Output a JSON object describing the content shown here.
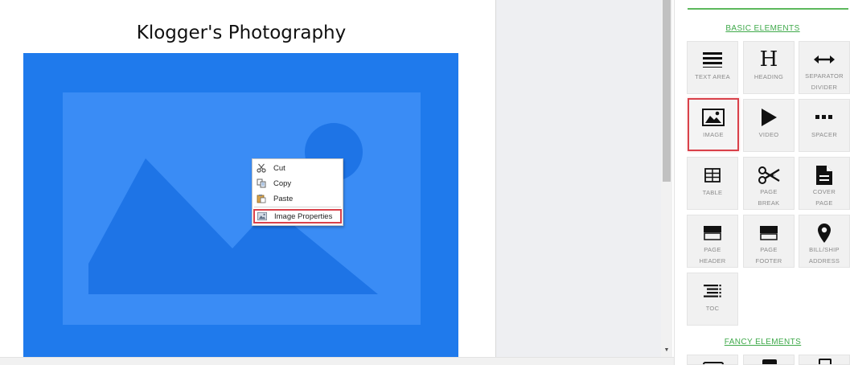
{
  "document": {
    "title": "Klogger's Photography"
  },
  "context_menu": {
    "items": [
      {
        "label": "Cut",
        "icon": "scissors-icon"
      },
      {
        "label": "Copy",
        "icon": "copy-icon"
      },
      {
        "label": "Paste",
        "icon": "paste-icon"
      },
      {
        "label": "Image Properties",
        "icon": "image-properties-icon",
        "highlighted": true
      }
    ]
  },
  "panel": {
    "basic_title": "BASIC ELEMENTS",
    "fancy_title": "FANCY ELEMENTS",
    "tiles": [
      {
        "label1": "TEXT AREA",
        "label2": "",
        "icon": "text-area-icon"
      },
      {
        "label1": "HEADING",
        "label2": "",
        "icon": "heading-icon"
      },
      {
        "label1": "SEPARATOR",
        "label2": "DIVIDER",
        "icon": "separator-icon"
      },
      {
        "label1": "IMAGE",
        "label2": "",
        "icon": "image-icon",
        "selected": true
      },
      {
        "label1": "VIDEO",
        "label2": "",
        "icon": "video-icon"
      },
      {
        "label1": "SPACER",
        "label2": "",
        "icon": "spacer-icon"
      },
      {
        "label1": "TABLE",
        "label2": "",
        "icon": "table-icon"
      },
      {
        "label1": "PAGE",
        "label2": "BREAK",
        "icon": "page-break-icon"
      },
      {
        "label1": "COVER",
        "label2": "PAGE",
        "icon": "cover-page-icon"
      },
      {
        "label1": "PAGE",
        "label2": "HEADER",
        "icon": "page-header-icon"
      },
      {
        "label1": "PAGE",
        "label2": "FOOTER",
        "icon": "page-footer-icon"
      },
      {
        "label1": "BILL/SHIP",
        "label2": "ADDRESS",
        "icon": "map-pin-icon"
      },
      {
        "label1": "TOC",
        "label2": "",
        "icon": "toc-icon"
      }
    ]
  },
  "colors": {
    "image_placeholder_bg": "#1f7aec",
    "image_placeholder_shape": "#3a8cf5",
    "accent_green": "#3fa94a",
    "highlight_red": "#d9414a"
  }
}
